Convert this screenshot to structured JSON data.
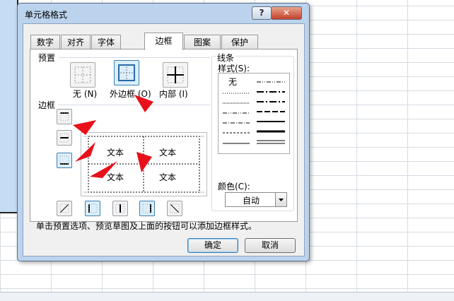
{
  "dialog": {
    "title": "单元格格式",
    "help_label": "?",
    "close_label": "✕",
    "tabs": [
      {
        "label": "数字"
      },
      {
        "label": "对齐"
      },
      {
        "label": "字体"
      },
      {
        "label": "边框",
        "active": true
      },
      {
        "label": "图案"
      },
      {
        "label": "保护"
      }
    ],
    "presets": {
      "group_label": "预置",
      "items": [
        {
          "label": "无 (N)",
          "icon": "border-none-icon"
        },
        {
          "label": "外边框 (O)",
          "icon": "border-outline-icon",
          "selected": true
        },
        {
          "label": "内部 (I)",
          "icon": "border-inside-icon"
        }
      ]
    },
    "border": {
      "group_label": "边框",
      "preview_texts": [
        "文本",
        "文本",
        "文本",
        "文本"
      ]
    },
    "line": {
      "group_label": "线条",
      "style_label": "样式(S):",
      "none_label": "无",
      "color_label": "颜色(C):",
      "color_value": "自动"
    },
    "description": "单击预置选项、预览草图及上面的按钮可以添加边框样式。",
    "ok_label": "确定",
    "cancel_label": "取消"
  },
  "colors": {
    "dialog_frame": "#bcd3ee",
    "arrow": "#e8101a",
    "selected_button": "#dbeefc",
    "close_button": "#c4412a"
  }
}
